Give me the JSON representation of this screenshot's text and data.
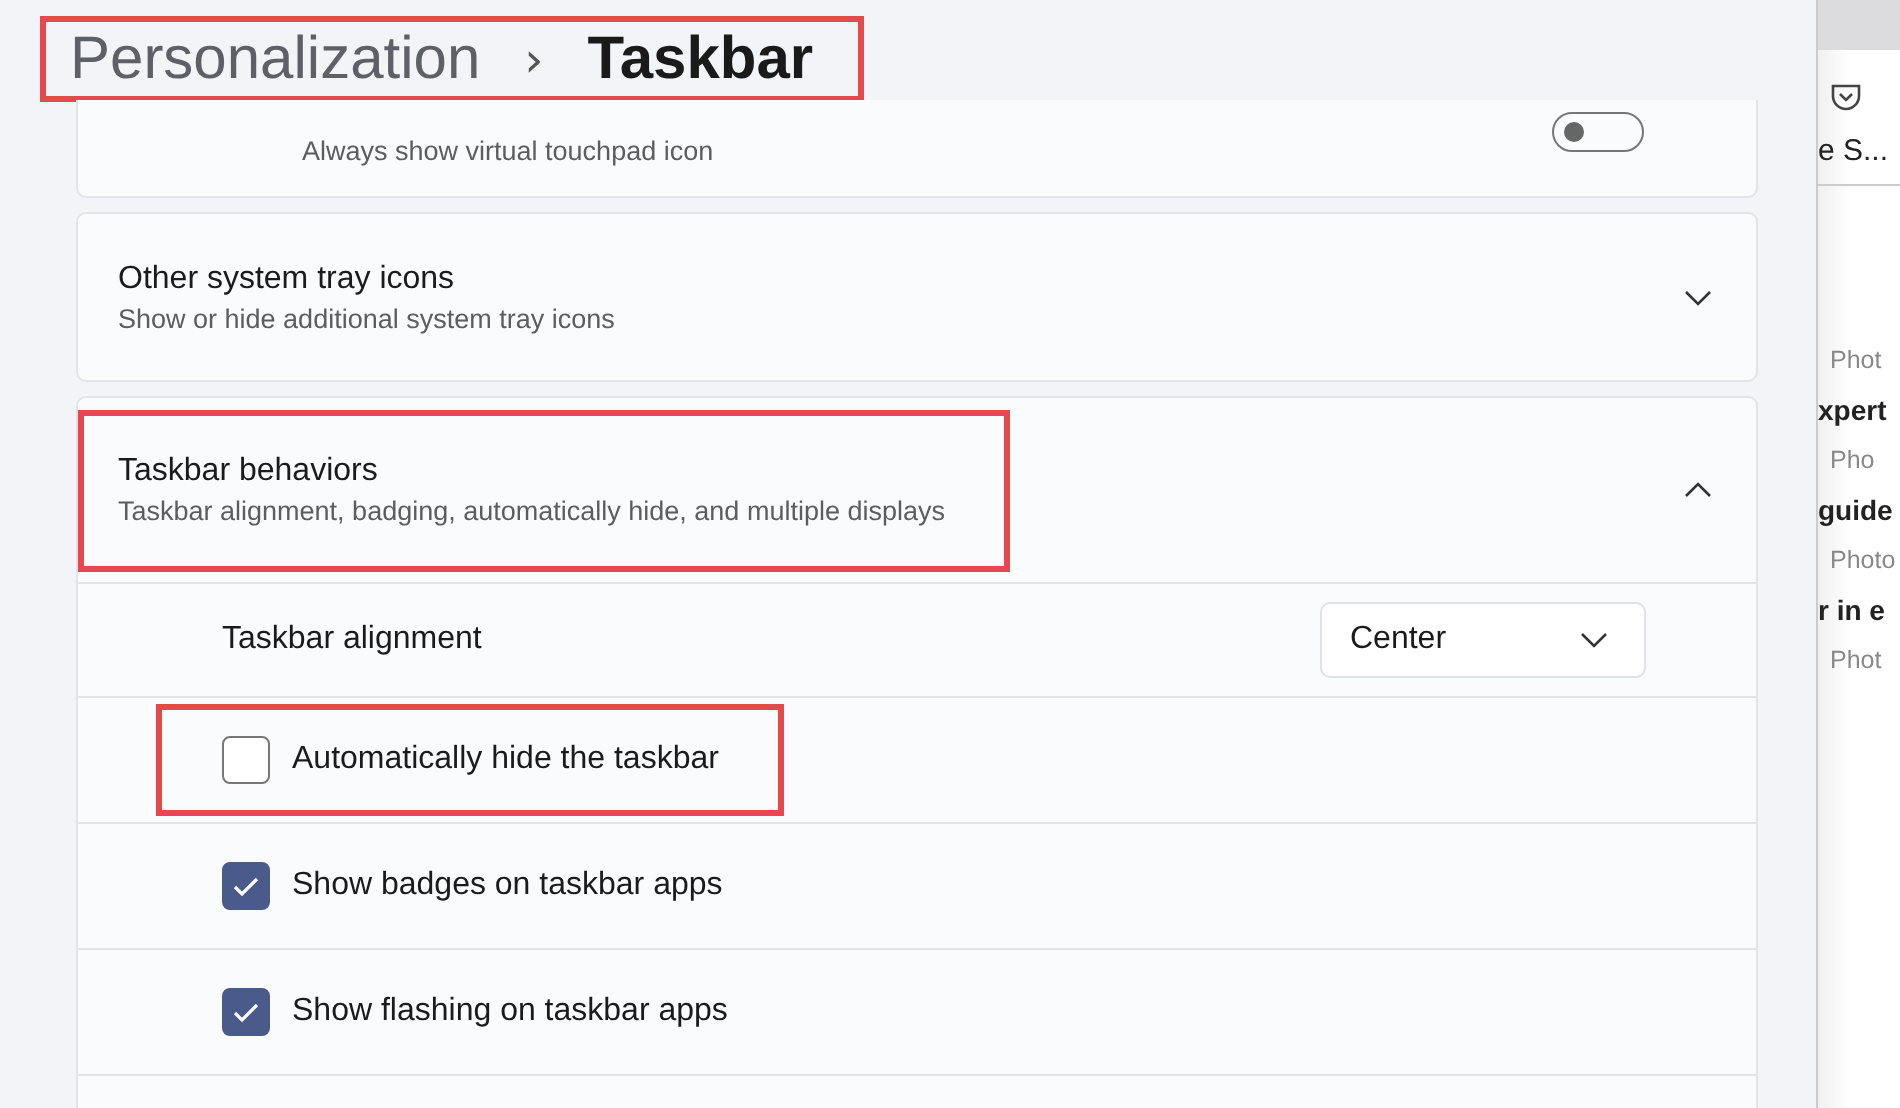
{
  "breadcrumb": {
    "parent": "Personalization",
    "separator": "›",
    "current": "Taskbar",
    "highlighted": true
  },
  "cards": [
    {
      "kind": "partial",
      "subtitle": "Always show virtual touchpad icon",
      "on": false
    },
    {
      "kind": "expander",
      "title": "Other system tray icons",
      "subtitle": "Show or hide additional system tray icons",
      "expanded": false,
      "highlighted": false
    },
    {
      "kind": "expander",
      "title": "Taskbar behaviors",
      "subtitle": "Taskbar alignment, badging, automatically hide, and multiple displays",
      "expanded": true,
      "highlighted": true,
      "settings": [
        {
          "kind": "dropdown",
          "label": "Taskbar alignment",
          "value": "Center"
        },
        {
          "kind": "checkbox",
          "label": "Automatically hide the taskbar",
          "checked": false,
          "highlighted": true
        },
        {
          "kind": "checkbox",
          "label": "Show badges on taskbar apps",
          "checked": true,
          "highlighted": false
        },
        {
          "kind": "checkbox",
          "label": "Show flashing on taskbar apps",
          "checked": true,
          "highlighted": false
        }
      ]
    }
  ],
  "browser": {
    "tab": "e S...",
    "items": [
      {
        "kind": "meta",
        "text": "Phot"
      },
      {
        "kind": "title",
        "text": "xpert"
      },
      {
        "kind": "meta",
        "text": "Pho"
      },
      {
        "kind": "title",
        "text": "guide"
      },
      {
        "kind": "meta",
        "text": "Photo"
      },
      {
        "kind": "title",
        "text": "r in e"
      },
      {
        "kind": "meta",
        "text": "Phot"
      }
    ]
  }
}
